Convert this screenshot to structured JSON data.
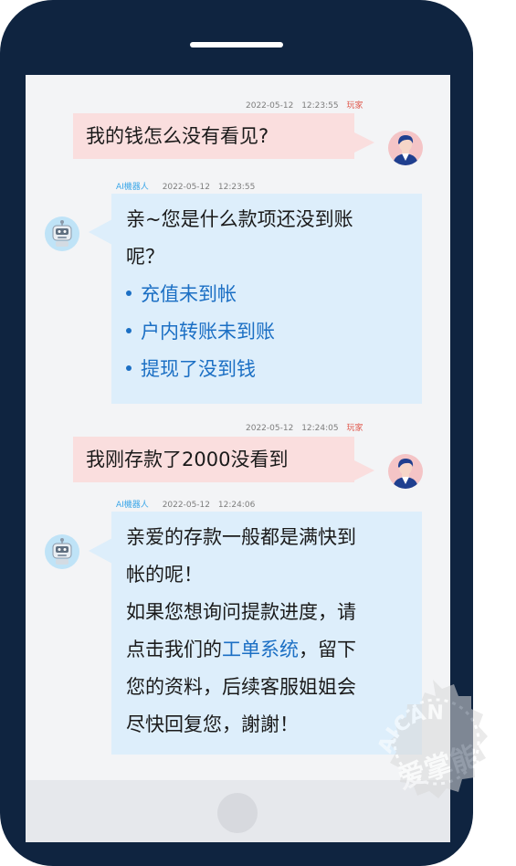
{
  "conversation": [
    {
      "role": "player",
      "role_label": "玩家",
      "date": "2022-05-12",
      "time": "12:23:55",
      "text": "我的钱怎么没有看见?"
    },
    {
      "role": "bot",
      "role_label": "AI機器人",
      "date": "2022-05-12",
      "time": "12:23:55",
      "lines": [
        "亲~您是什么款项还没到账",
        "呢？"
      ],
      "options": [
        "充值未到帐",
        "户内转账未到账",
        "提现了没到钱"
      ]
    },
    {
      "role": "player",
      "role_label": "玩家",
      "date": "2022-05-12",
      "time": "12:24:05",
      "text": "我刚存款了2000没看到"
    },
    {
      "role": "bot",
      "role_label": "AI機器人",
      "date": "2022-05-12",
      "time": "12:24:06",
      "lines_before": [
        "亲爱的存款一般都是满快到",
        "帐的呢！",
        "如果您想询问提款进度，请"
      ],
      "link_prefix": "点击我们的",
      "link_text": "工单系统",
      "link_suffix": "，留下",
      "lines_after": [
        "您的资料，后续客服姐姐会",
        "尽快回复您，謝謝！"
      ]
    }
  ],
  "watermark": {
    "text_top": "AICAN",
    "text_bottom": "爱掌能"
  },
  "colors": {
    "phone_frame": "#0f2440",
    "user_bubble": "#fadede",
    "bot_bubble": "#ddeefb",
    "link": "#1b6fc4",
    "player_label": "#e05a4f",
    "bot_label": "#3aa6e8"
  }
}
